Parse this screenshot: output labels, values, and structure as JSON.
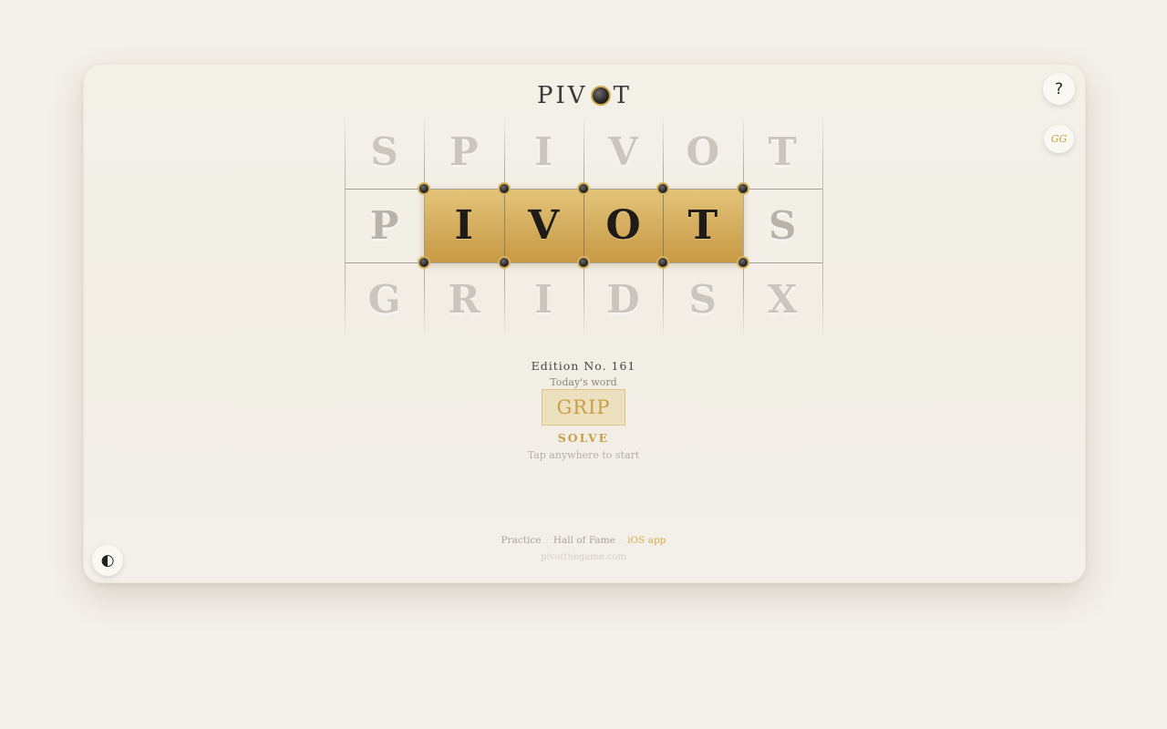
{
  "app": {
    "name_left": "PIV",
    "name_right": "T"
  },
  "controls": {
    "help_label": "?",
    "gg_label": "GG",
    "theme_label": "◐"
  },
  "board": {
    "rows": [
      [
        "S",
        "P",
        "I",
        "V",
        "O",
        "T"
      ],
      [
        "P",
        "I",
        "V",
        "O",
        "T",
        "S"
      ],
      [
        "G",
        "R",
        "I",
        "D",
        "S",
        "X"
      ]
    ],
    "active_row": 1,
    "active_cols": [
      1,
      2,
      3,
      4
    ],
    "accent_color": "#d4ad5e"
  },
  "info": {
    "edition": "Edition No. 161",
    "today_label": "Today's word",
    "word": "GRIP",
    "solve_label": "SOLVE",
    "hint": "Tap anywhere to start"
  },
  "footer": {
    "practice": "Practice",
    "sep": "·",
    "hall_of_fame": "Hall of Fame",
    "ios_app": "iOS app",
    "site": "pivotthegame.com"
  }
}
